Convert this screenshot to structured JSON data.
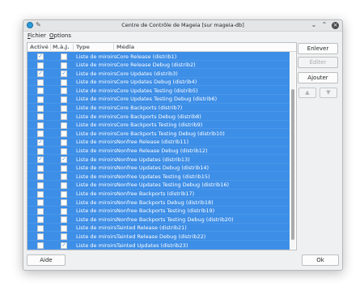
{
  "window": {
    "title": "Centre de Contrôle de Mageia [sur mageia-db]"
  },
  "menu": {
    "fichier": "Fichier",
    "fichier_key": "F",
    "fichier_rest": "ichier",
    "options": "Options",
    "options_key": "O",
    "options_rest": "ptions"
  },
  "table": {
    "headers": {
      "active": "Activé",
      "update": "M.à.J.",
      "type": "Type",
      "media": "Média"
    },
    "rows": [
      {
        "active": true,
        "update": false,
        "type": "Liste de miroirs",
        "media": "Core Release (distrib1)"
      },
      {
        "active": false,
        "update": false,
        "type": "Liste de miroirs",
        "media": "Core Release Debug (distrib2)"
      },
      {
        "active": true,
        "update": true,
        "type": "Liste de miroirs",
        "media": "Core Updates (distrib3)"
      },
      {
        "active": false,
        "update": false,
        "type": "Liste de miroirs",
        "media": "Core Updates Debug (distrib4)"
      },
      {
        "active": false,
        "update": false,
        "type": "Liste de miroirs",
        "media": "Core Updates Testing (distrib5)"
      },
      {
        "active": false,
        "update": false,
        "type": "Liste de miroirs",
        "media": "Core Updates Testing Debug (distrib6)"
      },
      {
        "active": false,
        "update": false,
        "type": "Liste de miroirs",
        "media": "Core Backports (distrib7)"
      },
      {
        "active": false,
        "update": false,
        "type": "Liste de miroirs",
        "media": "Core Backports Debug (distrib8)"
      },
      {
        "active": false,
        "update": false,
        "type": "Liste de miroirs",
        "media": "Core Backports Testing (distrib9)"
      },
      {
        "active": false,
        "update": false,
        "type": "Liste de miroirs",
        "media": "Core Backports Testing Debug (distrib10)"
      },
      {
        "active": true,
        "update": false,
        "type": "Liste de miroirs",
        "media": "Nonfree Release (distrib11)"
      },
      {
        "active": false,
        "update": false,
        "type": "Liste de miroirs",
        "media": "Nonfree Release Debug (distrib12)"
      },
      {
        "active": true,
        "update": true,
        "type": "Liste de miroirs",
        "media": "Nonfree Updates (distrib13)"
      },
      {
        "active": false,
        "update": false,
        "type": "Liste de miroirs",
        "media": "Nonfree Updates Debug (distrib14)"
      },
      {
        "active": false,
        "update": false,
        "type": "Liste de miroirs",
        "media": "Nonfree Updates Testing (distrib15)"
      },
      {
        "active": false,
        "update": false,
        "type": "Liste de miroirs",
        "media": "Nonfree Updates Testing Debug (distrib16)"
      },
      {
        "active": false,
        "update": false,
        "type": "Liste de miroirs",
        "media": "Nonfree Backports (distrib17)"
      },
      {
        "active": false,
        "update": false,
        "type": "Liste de miroirs",
        "media": "Nonfree Backports Debug (distrib18)"
      },
      {
        "active": false,
        "update": false,
        "type": "Liste de miroirs",
        "media": "Nonfree Backports Testing (distrib19)"
      },
      {
        "active": false,
        "update": false,
        "type": "Liste de miroirs",
        "media": "Nonfree Backports Testing Debug (distrib20)"
      },
      {
        "active": false,
        "update": false,
        "type": "Liste de miroirs",
        "media": "Tainted Release (distrib21)"
      },
      {
        "active": false,
        "update": false,
        "type": "Liste de miroirs",
        "media": "Tainted Release Debug (distrib22)"
      },
      {
        "active": false,
        "update": true,
        "type": "Liste de miroirs",
        "media": "Tainted Updates (distrib23)"
      }
    ]
  },
  "side_buttons": {
    "remove": "Enlever",
    "edit": "Éditer",
    "add": "Ajouter",
    "up_icon": "arrow-up-icon",
    "down_icon": "arrow-down-icon"
  },
  "bottom_buttons": {
    "help": "Aide",
    "ok": "Ok"
  },
  "colors": {
    "selection": "#3d8ee7",
    "window_bg": "#eff0f1"
  }
}
